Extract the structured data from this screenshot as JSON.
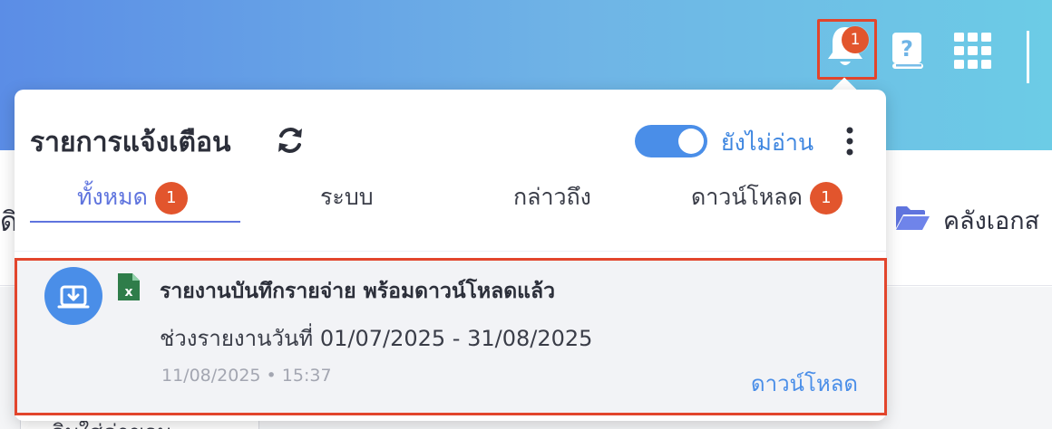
{
  "header": {
    "notification_count": "1",
    "icons": [
      "bell-icon",
      "help-book-icon",
      "apps-grid-icon"
    ]
  },
  "background": {
    "left_partial_text": "ดิ",
    "documents_label": "คลังเอกส",
    "bottom_partial_text": "ดิบ​ใส่​ค่าขอบ"
  },
  "panel": {
    "title": "รายการแจ้งเตือน",
    "unread_toggle_label": "ยังไม่อ่าน",
    "unread_toggle_on": true,
    "tabs": [
      {
        "label": "ทั้งหมด",
        "badge": "1",
        "active": true
      },
      {
        "label": "ระบบ",
        "badge": "",
        "active": false
      },
      {
        "label": "กล่าวถึง",
        "badge": "",
        "active": false
      },
      {
        "label": "ดาวน์โหลด",
        "badge": "1",
        "active": false
      }
    ]
  },
  "notifications": [
    {
      "title": "รายงานบันทึกรายจ่าย พร้อมดาวน์โหลดแล้ว",
      "description": "ช่วงรายงานวันที่ 01/07/2025 - 31/08/2025",
      "timestamp": "11/08/2025 • 15:37",
      "action_label": "ดาวน์โหลด",
      "file_type": "excel-icon"
    }
  ],
  "colors": {
    "accent": "#4a8ee8",
    "tab_active": "#5f74de",
    "badge": "#e2552d",
    "highlight_border": "#e2452c"
  }
}
